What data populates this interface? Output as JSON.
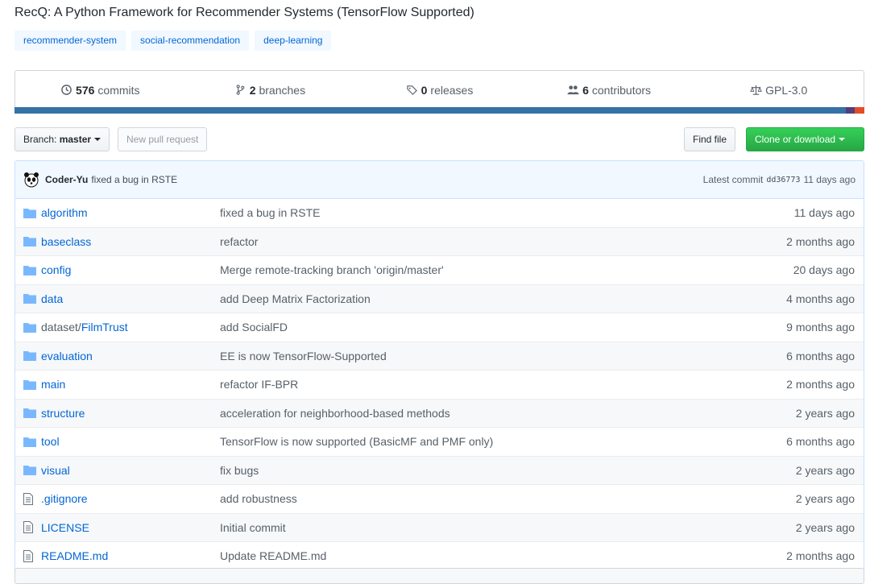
{
  "repo": {
    "description": "RecQ: A Python Framework for Recommender Systems (TensorFlow Supported)",
    "topics": [
      "recommender-system",
      "social-recommendation",
      "deep-learning"
    ]
  },
  "summary": {
    "commits": {
      "count": "576",
      "label": "commits"
    },
    "branches": {
      "count": "2",
      "label": "branches"
    },
    "releases": {
      "count": "0",
      "label": "releases"
    },
    "contributors": {
      "count": "6",
      "label": "contributors"
    },
    "license": "GPL-3.0"
  },
  "language_bar": [
    {
      "color": "#3572A5",
      "share": 0.978
    },
    {
      "color": "#563d7c",
      "share": 0.011
    },
    {
      "color": "#e34c26",
      "share": 0.011
    }
  ],
  "toolbar": {
    "branch_prefix": "Branch:",
    "branch": "master",
    "new_pr": "New pull request",
    "find_file": "Find file",
    "clone": "Clone or download"
  },
  "latest_commit": {
    "author": "Coder-Yu",
    "message": "fixed a bug in RSTE",
    "label": "Latest commit",
    "sha": "dd36773",
    "age": "11 days ago"
  },
  "files": [
    {
      "type": "dir",
      "name": "algorithm",
      "message": "fixed a bug in RSTE",
      "age": "11 days ago"
    },
    {
      "type": "dir",
      "name": "baseclass",
      "message": "refactor",
      "age": "2 months ago"
    },
    {
      "type": "dir",
      "name": "config",
      "message": "Merge remote-tracking branch 'origin/master'",
      "age": "20 days ago"
    },
    {
      "type": "dir",
      "name": "data",
      "message": "add Deep Matrix Factorization",
      "age": "4 months ago"
    },
    {
      "type": "dir",
      "name_prefix": "dataset/",
      "name": "FilmTrust",
      "message": "add SocialFD",
      "age": "9 months ago"
    },
    {
      "type": "dir",
      "name": "evaluation",
      "message": "EE is now TensorFlow-Supported",
      "age": "6 months ago"
    },
    {
      "type": "dir",
      "name": "main",
      "message": "refactor IF-BPR",
      "age": "2 months ago"
    },
    {
      "type": "dir",
      "name": "structure",
      "message": "acceleration for neighborhood-based methods",
      "age": "2 years ago"
    },
    {
      "type": "dir",
      "name": "tool",
      "message": "TensorFlow is now supported (BasicMF and PMF only)",
      "age": "6 months ago"
    },
    {
      "type": "dir",
      "name": "visual",
      "message": "fix bugs",
      "age": "2 years ago"
    },
    {
      "type": "file",
      "name": ".gitignore",
      "message": "add robustness",
      "age": "2 years ago"
    },
    {
      "type": "file",
      "name": "LICENSE",
      "message": "Initial commit",
      "age": "2 years ago"
    },
    {
      "type": "file",
      "name": "README.md",
      "message": "Update README.md",
      "age": "2 months ago"
    }
  ]
}
